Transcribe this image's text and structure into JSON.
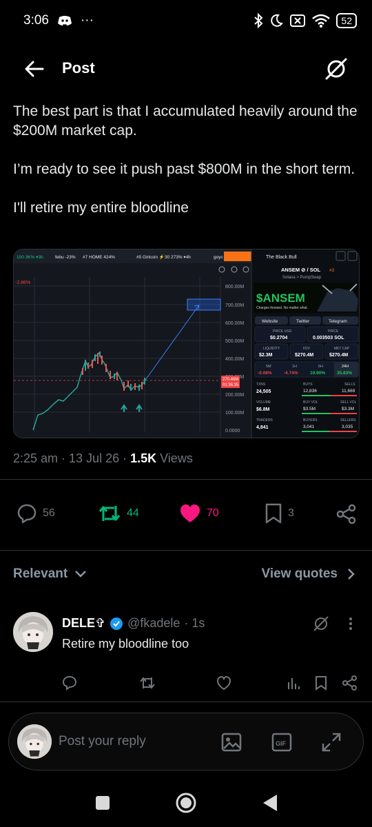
{
  "status": {
    "time": "3:06",
    "dots": "···",
    "battery": "52"
  },
  "header": {
    "title": "Post"
  },
  "post": {
    "paragraphs": [
      "The best part is that I accumulated heavily around the $200M market cap.",
      "I’m ready to see it push past $800M in the short term.",
      "I'll retire my entire bloodline"
    ]
  },
  "media": {
    "tabs": [
      "100 3K% ▾3h",
      "febu -23%",
      "#7 HOME 424%",
      "#5 Girlcoin ⚡30 273% ▾4h",
      "goyc"
    ],
    "chart_pct": "-2.86%",
    "y_ticks": [
      "800.00M",
      "700.00M",
      "600.00M",
      "500.00M",
      "400.00M",
      "300.00M",
      "200.00M",
      "100.00M",
      "0.0000"
    ],
    "price_tag": "270.46M",
    "price_tag_time": "01:36:35",
    "panel_title": "The Black Bull",
    "pair": "ANSEM ⊘ / SOL",
    "rank": "#3",
    "chain": "Solana > PumpSwap",
    "banner_title": "$ANSEM",
    "banner_sub": "Charges forward. No matter what.",
    "links": [
      "Website",
      "Twitter",
      "Telegram"
    ],
    "price_usd_label": "PRICE USD",
    "price_usd": "$0.2704",
    "price_sol_label": "PRICE",
    "price_sol": "0.003503 SOL",
    "liquidity_label": "LIQUIDITY",
    "liquidity": "$2.3M",
    "fdv_label": "FDV",
    "fdv": "$270.4M",
    "mcap_label": "MKT CAP",
    "mcap": "$270.4M",
    "periods": [
      {
        "label": "5M",
        "value": "-0.08%"
      },
      {
        "label": "1H",
        "value": "-4.74%"
      },
      {
        "label": "6H",
        "value": "19.90%"
      },
      {
        "label": "24H",
        "value": "35.83%"
      }
    ],
    "txns_label": "TXNS",
    "txns": "24,505",
    "buys_label": "BUYS",
    "buys": "12,836",
    "sells_label": "SELLS",
    "sells": "11,669",
    "volume_label": "VOLUME",
    "volume": "$6.8M",
    "buyvol_label": "BUY VOL",
    "buyvol": "$3.5M",
    "sellvol_label": "SELL VOL",
    "sellvol": "$3.3M",
    "traders_label": "TRADERS",
    "traders": "4,841",
    "buyers_label": "BUYERS",
    "buyers": "3,041",
    "sellers_label": "SELLERS",
    "sellers": "3,035"
  },
  "meta": {
    "time": "2:25 am · 13 Jul 26 · ",
    "views_count": "1.5K",
    "views_label": " Views"
  },
  "actions": {
    "replies": "56",
    "reposts": "44",
    "likes": "70",
    "bookmarks": "3"
  },
  "filter": {
    "relevant": "Relevant",
    "view_quotes": "View quotes"
  },
  "reply": {
    "name": "DELE✞",
    "handle": "@fkadele",
    "time": "· 1s",
    "text": "Retire my bloodline too"
  },
  "composer": {
    "placeholder": "Post your reply"
  },
  "colors": {
    "accent": "#1d9bf0",
    "like": "#f91880",
    "repost": "#00ba7c",
    "muted": "#71767b"
  }
}
